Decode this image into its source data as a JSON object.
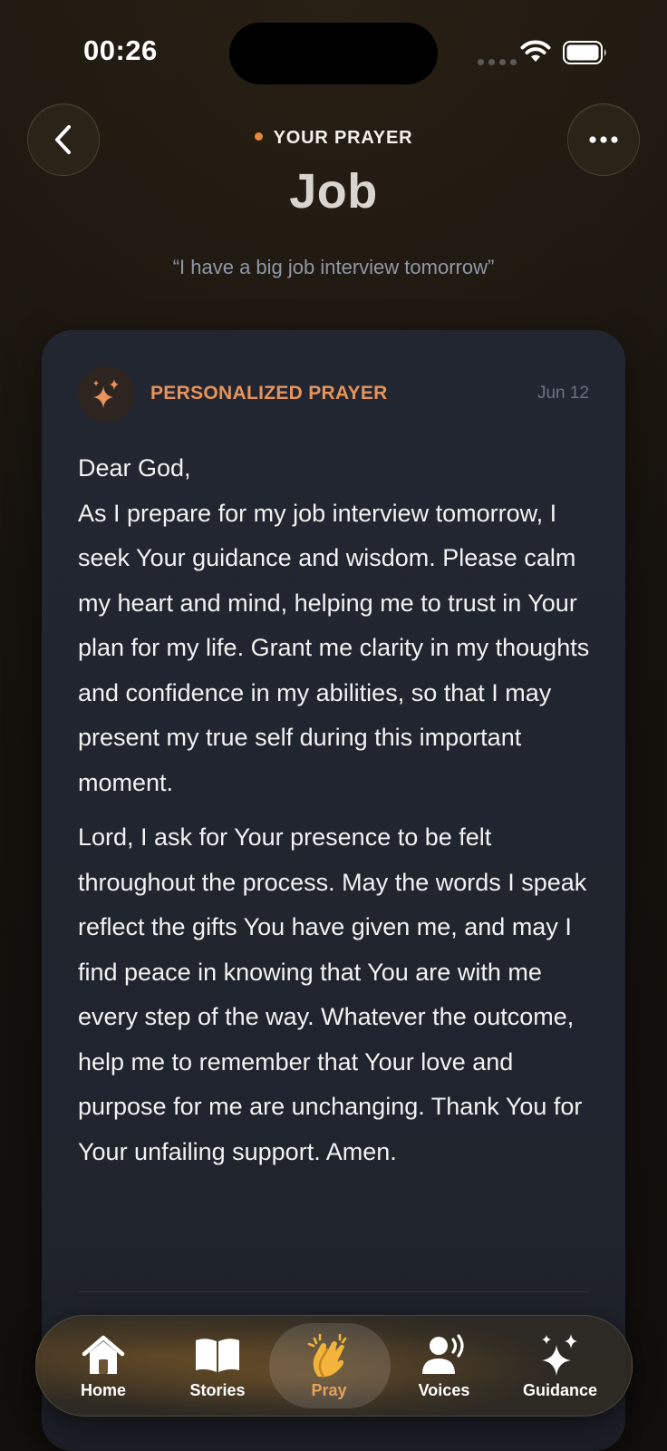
{
  "status_bar": {
    "time": "00:26"
  },
  "header": {
    "kicker": "YOUR PRAYER",
    "title": "Job",
    "quote": "“I have a big job interview tomorrow”"
  },
  "card": {
    "label": "PERSONALIZED PRAYER",
    "date": "Jun 12",
    "paragraphs": [
      "Dear God,\nAs I prepare for my job interview tomorrow, I seek Your guidance and wisdom. Please calm my heart and mind, helping me to trust in Your plan for my life. Grant me clarity in my thoughts and confidence in my abilities, so that I may present my true self during this important moment.",
      "Lord, I ask for Your presence to be felt throughout the process. May the words I speak reflect the gifts You have given me, and may I find peace in knowing that You are with me every step of the way. Whatever the outcome, help me to remember that Your love and purpose for me are unchanging. Thank You for Your unfailing support. Amen."
    ]
  },
  "tabs": [
    {
      "label": "Home",
      "icon": "house-icon",
      "active": false
    },
    {
      "label": "Stories",
      "icon": "open-book-icon",
      "active": false
    },
    {
      "label": "Pray",
      "icon": "praying-hands-icon",
      "active": true
    },
    {
      "label": "Voices",
      "icon": "speaking-person-icon",
      "active": false
    },
    {
      "label": "Guidance",
      "icon": "sparkles-icon",
      "active": false
    }
  ],
  "colors": {
    "accent": "#e5873d",
    "card_label": "#e8935a",
    "card_background": "#21252e",
    "background": "#17130f"
  }
}
